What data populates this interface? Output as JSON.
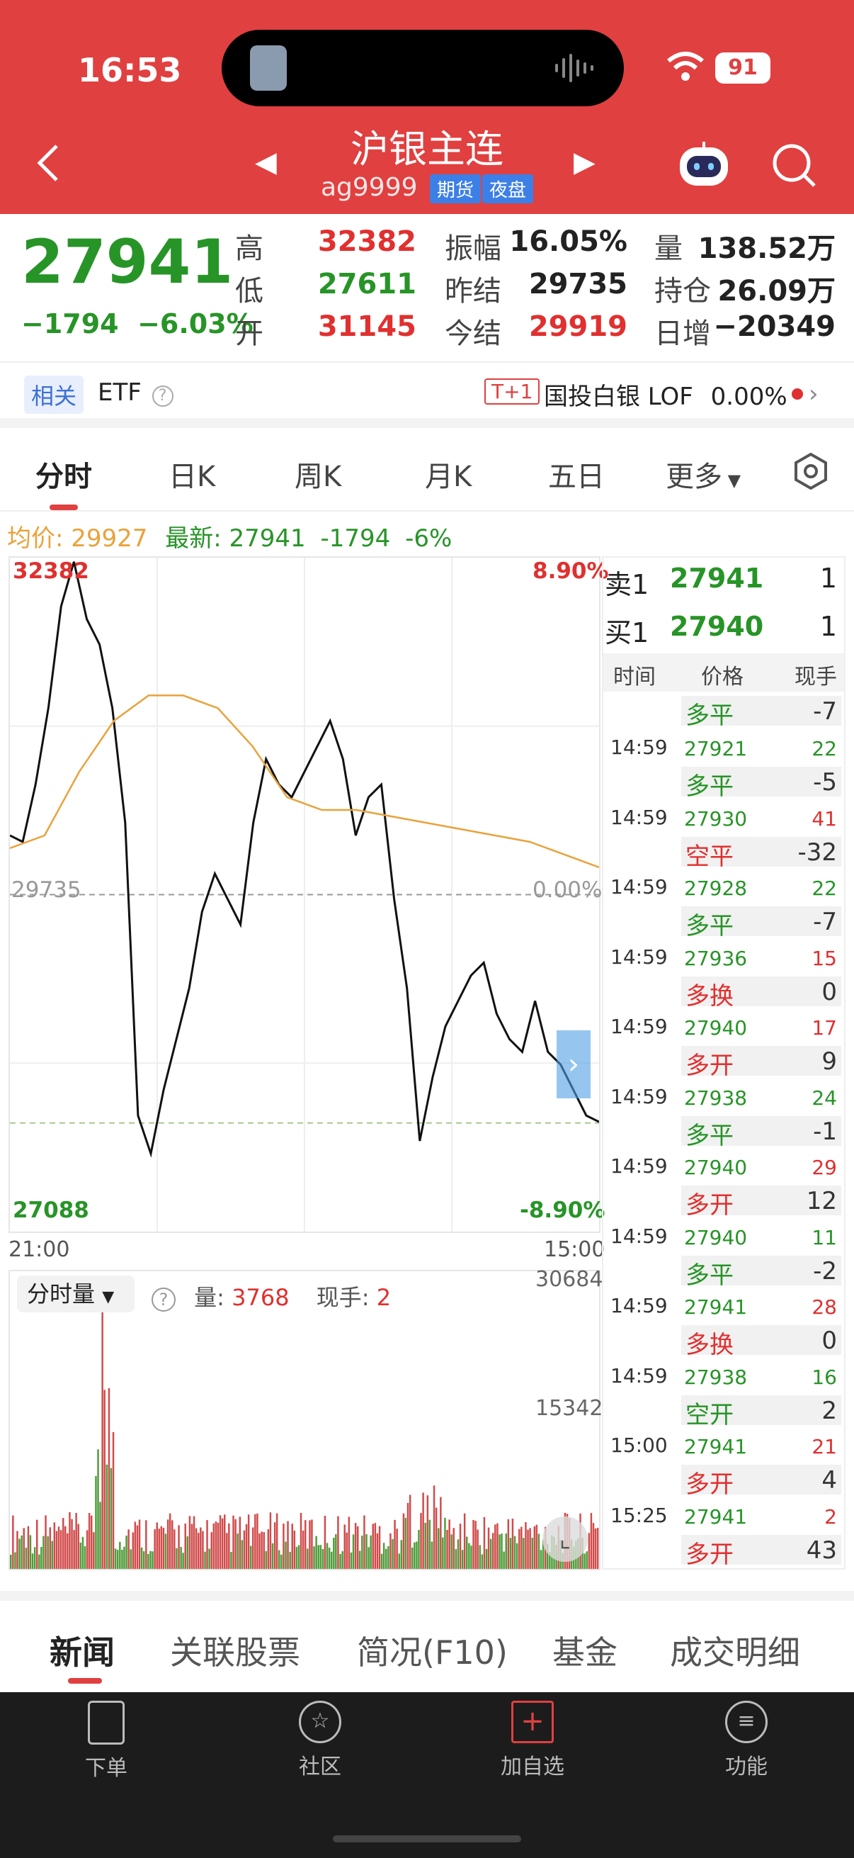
{
  "status": {
    "time": "16:53",
    "battery": "91"
  },
  "header": {
    "title": "沪银主连",
    "code": "ag9999",
    "tag_futures": "期货",
    "tag_night": "夜盘"
  },
  "quote": {
    "last": "27941",
    "change": "−1794",
    "change_pct": "−6.03%",
    "rows": [
      {
        "k1": "高",
        "v1": "32382",
        "c1": "red",
        "k2": "振幅",
        "v2": "16.05%",
        "c2": "dark",
        "k3": "量",
        "v3": "138.52万",
        "c3": "dark"
      },
      {
        "k1": "低",
        "v1": "27611",
        "c1": "green",
        "k2": "昨结",
        "v2": "29735",
        "c2": "dark",
        "k3": "持仓",
        "v3": "26.09万",
        "c3": "dark"
      },
      {
        "k1": "开",
        "v1": "31145",
        "c1": "red",
        "k2": "今结",
        "v2": "29919",
        "c2": "red",
        "k3": "日增",
        "v3": "−20349",
        "c3": "dark"
      }
    ]
  },
  "related": {
    "badge": "相关",
    "etf": "ETF",
    "tplus": "T+1",
    "fund_name": "国投白银 LOF",
    "fund_change": "0.00%"
  },
  "tabs": [
    "分时",
    "日K",
    "周K",
    "月K",
    "五日",
    "更多"
  ],
  "info": {
    "avg_label": "均价: 29927",
    "latest_label": "最新: 27941",
    "chg": "-1794",
    "pct": "-6%"
  },
  "chart_data": {
    "type": "line",
    "series": [
      {
        "name": "最新",
        "values": [
          30200,
          30150,
          30600,
          31200,
          32000,
          32350,
          31900,
          31700,
          31200,
          30300,
          28000,
          27700,
          28200,
          28600,
          29000,
          29600,
          29900,
          29700,
          29500,
          30300,
          30800,
          30600,
          30500,
          30700,
          30900,
          31100,
          30800,
          30200,
          30500,
          30600,
          29700,
          29000,
          27800,
          28300,
          28700,
          28900,
          29100,
          29200,
          28800,
          28600,
          28500,
          28900,
          28500,
          28400,
          28200,
          28000,
          27950
        ]
      },
      {
        "name": "均价",
        "values": [
          30100,
          30200,
          30700,
          31100,
          31300,
          31300,
          31200,
          30900,
          30500,
          30400,
          30400,
          30350,
          30300,
          30250,
          30200,
          30150,
          30050,
          29950
        ]
      }
    ],
    "x_ticks": [
      "21:00",
      "15:00"
    ],
    "ylim": [
      27088,
      32382
    ],
    "y_labels": {
      "top": "32382",
      "mid": "29735",
      "bottom": "27088",
      "top_pct": "8.90%",
      "mid_pct": "0.00%",
      "bottom_pct": "-8.90%"
    },
    "volume": {
      "label": "分时量",
      "amount_label": "量:",
      "amount": "3768",
      "hand_label": "现手:",
      "hand": "2",
      "max": "30684",
      "mid": "15342"
    }
  },
  "book": {
    "sell": {
      "label": "卖1",
      "price": "27941",
      "qty": "1"
    },
    "buy": {
      "label": "买1",
      "price": "27940",
      "qty": "1"
    },
    "headers": [
      "时间",
      "价格",
      "现手"
    ],
    "first": {
      "type": "多平",
      "n": "-7"
    },
    "trades": [
      {
        "t": "14:59",
        "p": "27921",
        "q": "22",
        "qc": "green",
        "ty": "多平",
        "tyc": "green",
        "n": "-5"
      },
      {
        "t": "14:59",
        "p": "27930",
        "q": "41",
        "qc": "red",
        "ty": "空平",
        "tyc": "red",
        "n": "-32"
      },
      {
        "t": "14:59",
        "p": "27928",
        "q": "22",
        "qc": "green",
        "ty": "多平",
        "tyc": "green",
        "n": "-7"
      },
      {
        "t": "14:59",
        "p": "27936",
        "q": "15",
        "qc": "red",
        "ty": "多换",
        "tyc": "red",
        "n": "0"
      },
      {
        "t": "14:59",
        "p": "27940",
        "q": "17",
        "qc": "red",
        "ty": "多开",
        "tyc": "red",
        "n": "9"
      },
      {
        "t": "14:59",
        "p": "27938",
        "q": "24",
        "qc": "green",
        "ty": "多平",
        "tyc": "green",
        "n": "-1"
      },
      {
        "t": "14:59",
        "p": "27940",
        "q": "29",
        "qc": "red",
        "ty": "多开",
        "tyc": "red",
        "n": "12"
      },
      {
        "t": "14:59",
        "p": "27940",
        "q": "11",
        "qc": "green",
        "ty": "多平",
        "tyc": "green",
        "n": "-2"
      },
      {
        "t": "14:59",
        "p": "27941",
        "q": "28",
        "qc": "red",
        "ty": "多换",
        "tyc": "red",
        "n": "0"
      },
      {
        "t": "14:59",
        "p": "27938",
        "q": "16",
        "qc": "green",
        "ty": "空开",
        "tyc": "green",
        "n": "2"
      },
      {
        "t": "15:00",
        "p": "27941",
        "q": "21",
        "qc": "red",
        "ty": "多开",
        "tyc": "red",
        "n": "4"
      },
      {
        "t": "15:25",
        "p": "27941",
        "q": "2",
        "qc": "red",
        "ty": "多开",
        "tyc": "red",
        "n": "43"
      }
    ]
  },
  "bottom_tabs": [
    "新闻",
    "关联股票",
    "简况(F10)",
    "基金",
    "成交明细"
  ],
  "nav": [
    "下单",
    "社区",
    "加自选",
    "功能"
  ],
  "colors": {
    "header": "#e04040",
    "up": "#e0302f",
    "down": "#279427",
    "avg": "#e9a23b"
  }
}
